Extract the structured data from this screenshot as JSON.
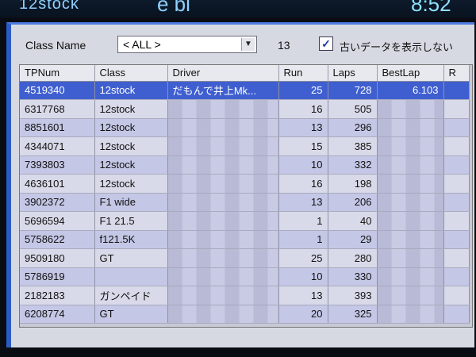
{
  "topbar": {
    "left": "12stock",
    "mid": "e bl",
    "right": "8:52"
  },
  "controls": {
    "class_label": "Class Name",
    "class_value": "< ALL >",
    "count": "13",
    "checkbox_checked": "✓",
    "checkbox_label": "古いデータを表示しない"
  },
  "table": {
    "headers": [
      "TPNum",
      "Class",
      "Driver",
      "Run",
      "Laps",
      "BestLap",
      "R"
    ],
    "rows": [
      {
        "tp": "4519340",
        "class": "12stock",
        "driver": "だもんで井上Mk...",
        "run": "25",
        "laps": "728",
        "best": "6.103"
      },
      {
        "tp": "6317768",
        "class": "12stock",
        "driver": "",
        "run": "16",
        "laps": "505",
        "best": ""
      },
      {
        "tp": "8851601",
        "class": "12stock",
        "driver": "",
        "run": "13",
        "laps": "296",
        "best": ""
      },
      {
        "tp": "4344071",
        "class": "12stock",
        "driver": "",
        "run": "15",
        "laps": "385",
        "best": ""
      },
      {
        "tp": "7393803",
        "class": "12stock",
        "driver": "",
        "run": "10",
        "laps": "332",
        "best": ""
      },
      {
        "tp": "4636101",
        "class": "12stock",
        "driver": "",
        "run": "16",
        "laps": "198",
        "best": ""
      },
      {
        "tp": "3902372",
        "class": "F1 wide",
        "driver": "",
        "run": "13",
        "laps": "206",
        "best": ""
      },
      {
        "tp": "5696594",
        "class": "F1 21.5",
        "driver": "",
        "run": "1",
        "laps": "40",
        "best": ""
      },
      {
        "tp": "5758622",
        "class": "f121.5K",
        "driver": "",
        "run": "1",
        "laps": "29",
        "best": ""
      },
      {
        "tp": "9509180",
        "class": "GT",
        "driver": "",
        "run": "25",
        "laps": "280",
        "best": ""
      },
      {
        "tp": "5786919",
        "class": "",
        "driver": "",
        "run": "10",
        "laps": "330",
        "best": ""
      },
      {
        "tp": "2182183",
        "class": "ガンペイド",
        "driver": "",
        "run": "13",
        "laps": "393",
        "best": ""
      },
      {
        "tp": "6208774",
        "class": "GT",
        "driver": "",
        "run": "20",
        "laps": "325",
        "best": ""
      }
    ]
  }
}
